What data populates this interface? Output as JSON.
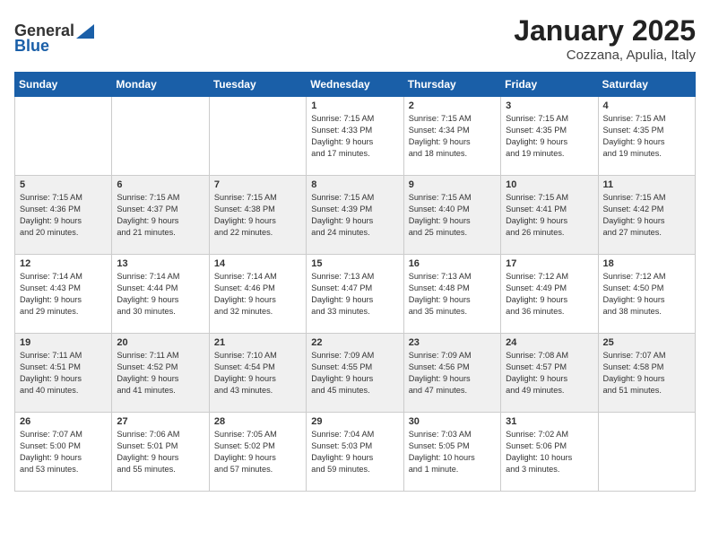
{
  "header": {
    "logo_general": "General",
    "logo_blue": "Blue",
    "title": "January 2025",
    "subtitle": "Cozzana, Apulia, Italy"
  },
  "calendar": {
    "days_of_week": [
      "Sunday",
      "Monday",
      "Tuesday",
      "Wednesday",
      "Thursday",
      "Friday",
      "Saturday"
    ],
    "weeks": [
      [
        {
          "day": "",
          "info": ""
        },
        {
          "day": "",
          "info": ""
        },
        {
          "day": "",
          "info": ""
        },
        {
          "day": "1",
          "info": "Sunrise: 7:15 AM\nSunset: 4:33 PM\nDaylight: 9 hours\nand 17 minutes."
        },
        {
          "day": "2",
          "info": "Sunrise: 7:15 AM\nSunset: 4:34 PM\nDaylight: 9 hours\nand 18 minutes."
        },
        {
          "day": "3",
          "info": "Sunrise: 7:15 AM\nSunset: 4:35 PM\nDaylight: 9 hours\nand 19 minutes."
        },
        {
          "day": "4",
          "info": "Sunrise: 7:15 AM\nSunset: 4:35 PM\nDaylight: 9 hours\nand 19 minutes."
        }
      ],
      [
        {
          "day": "5",
          "info": "Sunrise: 7:15 AM\nSunset: 4:36 PM\nDaylight: 9 hours\nand 20 minutes."
        },
        {
          "day": "6",
          "info": "Sunrise: 7:15 AM\nSunset: 4:37 PM\nDaylight: 9 hours\nand 21 minutes."
        },
        {
          "day": "7",
          "info": "Sunrise: 7:15 AM\nSunset: 4:38 PM\nDaylight: 9 hours\nand 22 minutes."
        },
        {
          "day": "8",
          "info": "Sunrise: 7:15 AM\nSunset: 4:39 PM\nDaylight: 9 hours\nand 24 minutes."
        },
        {
          "day": "9",
          "info": "Sunrise: 7:15 AM\nSunset: 4:40 PM\nDaylight: 9 hours\nand 25 minutes."
        },
        {
          "day": "10",
          "info": "Sunrise: 7:15 AM\nSunset: 4:41 PM\nDaylight: 9 hours\nand 26 minutes."
        },
        {
          "day": "11",
          "info": "Sunrise: 7:15 AM\nSunset: 4:42 PM\nDaylight: 9 hours\nand 27 minutes."
        }
      ],
      [
        {
          "day": "12",
          "info": "Sunrise: 7:14 AM\nSunset: 4:43 PM\nDaylight: 9 hours\nand 29 minutes."
        },
        {
          "day": "13",
          "info": "Sunrise: 7:14 AM\nSunset: 4:44 PM\nDaylight: 9 hours\nand 30 minutes."
        },
        {
          "day": "14",
          "info": "Sunrise: 7:14 AM\nSunset: 4:46 PM\nDaylight: 9 hours\nand 32 minutes."
        },
        {
          "day": "15",
          "info": "Sunrise: 7:13 AM\nSunset: 4:47 PM\nDaylight: 9 hours\nand 33 minutes."
        },
        {
          "day": "16",
          "info": "Sunrise: 7:13 AM\nSunset: 4:48 PM\nDaylight: 9 hours\nand 35 minutes."
        },
        {
          "day": "17",
          "info": "Sunrise: 7:12 AM\nSunset: 4:49 PM\nDaylight: 9 hours\nand 36 minutes."
        },
        {
          "day": "18",
          "info": "Sunrise: 7:12 AM\nSunset: 4:50 PM\nDaylight: 9 hours\nand 38 minutes."
        }
      ],
      [
        {
          "day": "19",
          "info": "Sunrise: 7:11 AM\nSunset: 4:51 PM\nDaylight: 9 hours\nand 40 minutes."
        },
        {
          "day": "20",
          "info": "Sunrise: 7:11 AM\nSunset: 4:52 PM\nDaylight: 9 hours\nand 41 minutes."
        },
        {
          "day": "21",
          "info": "Sunrise: 7:10 AM\nSunset: 4:54 PM\nDaylight: 9 hours\nand 43 minutes."
        },
        {
          "day": "22",
          "info": "Sunrise: 7:09 AM\nSunset: 4:55 PM\nDaylight: 9 hours\nand 45 minutes."
        },
        {
          "day": "23",
          "info": "Sunrise: 7:09 AM\nSunset: 4:56 PM\nDaylight: 9 hours\nand 47 minutes."
        },
        {
          "day": "24",
          "info": "Sunrise: 7:08 AM\nSunset: 4:57 PM\nDaylight: 9 hours\nand 49 minutes."
        },
        {
          "day": "25",
          "info": "Sunrise: 7:07 AM\nSunset: 4:58 PM\nDaylight: 9 hours\nand 51 minutes."
        }
      ],
      [
        {
          "day": "26",
          "info": "Sunrise: 7:07 AM\nSunset: 5:00 PM\nDaylight: 9 hours\nand 53 minutes."
        },
        {
          "day": "27",
          "info": "Sunrise: 7:06 AM\nSunset: 5:01 PM\nDaylight: 9 hours\nand 55 minutes."
        },
        {
          "day": "28",
          "info": "Sunrise: 7:05 AM\nSunset: 5:02 PM\nDaylight: 9 hours\nand 57 minutes."
        },
        {
          "day": "29",
          "info": "Sunrise: 7:04 AM\nSunset: 5:03 PM\nDaylight: 9 hours\nand 59 minutes."
        },
        {
          "day": "30",
          "info": "Sunrise: 7:03 AM\nSunset: 5:05 PM\nDaylight: 10 hours\nand 1 minute."
        },
        {
          "day": "31",
          "info": "Sunrise: 7:02 AM\nSunset: 5:06 PM\nDaylight: 10 hours\nand 3 minutes."
        },
        {
          "day": "",
          "info": ""
        }
      ]
    ]
  }
}
